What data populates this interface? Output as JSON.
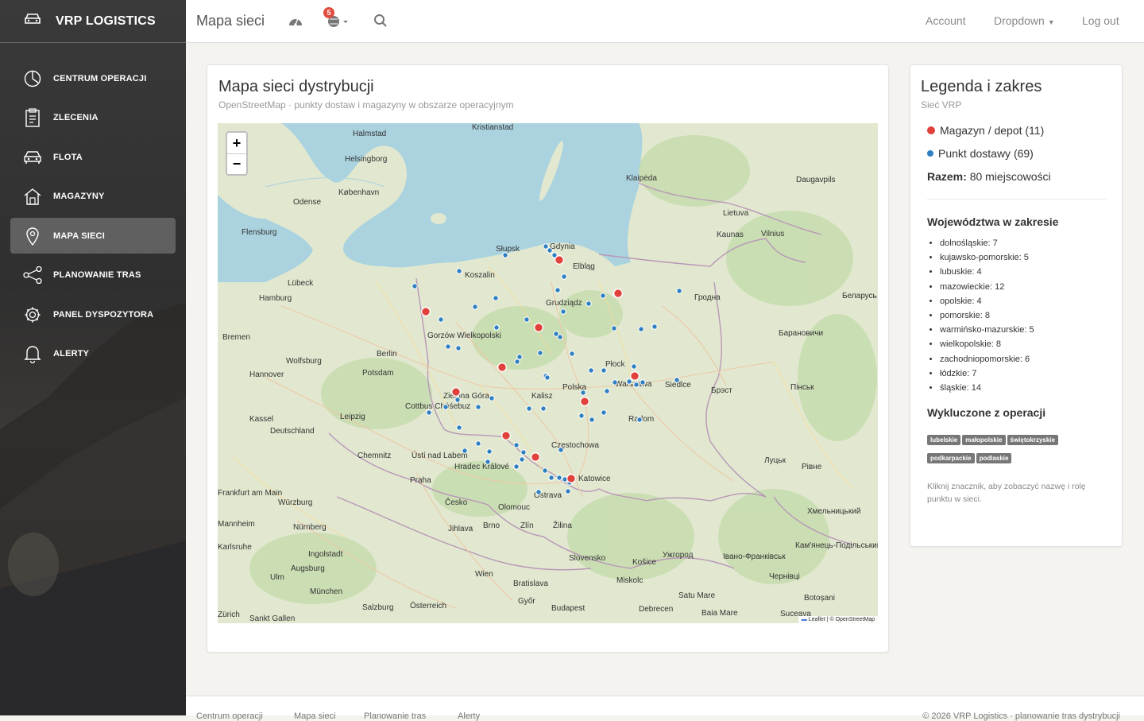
{
  "brand": {
    "name": "VRP LOGISTICS",
    "icon": "car-icon"
  },
  "sidebar": {
    "items": [
      {
        "label": "CENTRUM OPERACJI",
        "icon": "dashboard-icon",
        "active": false
      },
      {
        "label": "ZLECENIA",
        "icon": "clipboard-icon",
        "active": false
      },
      {
        "label": "FLOTA",
        "icon": "car-icon",
        "active": false
      },
      {
        "label": "MAGAZYNY",
        "icon": "warehouse-icon",
        "active": false
      },
      {
        "label": "MAPA SIECI",
        "icon": "map-pin-icon",
        "active": true
      },
      {
        "label": "PLANOWANIE TRAS",
        "icon": "share-icon",
        "active": false
      },
      {
        "label": "PANEL DYSPOZYTORA",
        "icon": "gear-icon",
        "active": false
      },
      {
        "label": "ALERTY",
        "icon": "bell-icon",
        "active": false
      }
    ]
  },
  "topbar": {
    "title": "Mapa sieci",
    "notifications_count": "5",
    "account": "Account",
    "dropdown": "Dropdown",
    "logout": "Log out"
  },
  "map_card": {
    "title": "Mapa sieci dystrybucji",
    "subtitle": "OpenStreetMap · punkty dostaw i magazyny w obszarze operacyjnym",
    "zoom_in": "+",
    "zoom_out": "−",
    "attribution": "Leaflet | © OpenStreetMap",
    "labels": [
      "Halmstad",
      "Helsingborg",
      "København",
      "Odense",
      "Flensburg",
      "Lübeck",
      "Hamburg",
      "Bremen",
      "Berlin",
      "Hannover",
      "Wolfsburg",
      "Potsdam",
      "Leipzig",
      "Kassel",
      "Deutschland",
      "Chemnitz",
      "Praha",
      "Česko",
      "Nürnberg",
      "Würzburg",
      "München",
      "Augsburg",
      "Ulm",
      "Zürich",
      "Wien",
      "Bratislava",
      "Budapest",
      "Brno",
      "Olomouc",
      "Zlín",
      "Žilina",
      "Slovensko",
      "Košice",
      "Ostrava",
      "Katowice",
      "Częstochowa",
      "Radom",
      "Warszawa",
      "Polska",
      "Płock",
      "Kalisz",
      "Zielona Góra",
      "Gorzów Wielkopolski",
      "Grudziądz",
      "Elbląg",
      "Słupsk",
      "Koszalin",
      "Gdynia",
      "Klaipėda",
      "Lietuva",
      "Kaunas",
      "Vilnius",
      "Гродна",
      "Беларусь",
      "Брэст",
      "Луцьк",
      "Рівне",
      "Ужгород",
      "Debrecen",
      "Miskolc",
      "Győr",
      "Salzburg",
      "Österreich",
      "Jihlava",
      "Hradec Králové",
      "Ústí nad Labem",
      "Siedlce",
      "Cottbus Chóśebuz",
      "Ingolstadt",
      "Sankt Gallen",
      "Frankfurt am Main",
      "Mannheim",
      "Karlsruhe",
      "Kristianstad",
      "Baia Mare",
      "Satu Mare",
      "Suceava",
      "Botoșani",
      "Daugavpils",
      "Барановичи",
      "Пінськ",
      "Кам'янець-Подільський",
      "Івано-Франківськ",
      "Чернівці",
      "Хмельницький"
    ],
    "markers": {
      "magazyn_color": "#e0413a",
      "punkt_color": "#2f7fc1"
    }
  },
  "legend": {
    "title": "Legenda i zakres",
    "subtitle": "Sieć VRP",
    "magazyn": "Magazyn / depot (11)",
    "punkt": "Punkt dostawy (69)",
    "total_label": "Razem:",
    "total_value": "80 miejscowości",
    "provinces_title": "Województwa w zakresie",
    "provinces": [
      "dolnośląskie: 7",
      "kujawsko-pomorskie: 5",
      "lubuskie: 4",
      "mazowieckie: 12",
      "opolskie: 4",
      "pomorskie: 8",
      "warmińsko-mazurskie: 5",
      "wielkopolskie: 8",
      "zachodniopomorskie: 6",
      "łódzkie: 7",
      "śląskie: 14"
    ],
    "excluded_title": "Wykluczone z operacji",
    "excluded": [
      "lubelskie",
      "małopolskie",
      "świętokrzyskie",
      "podkarpackie",
      "podlaskie"
    ],
    "hint": "Kliknij znacznik, aby zobaczyć nazwę i rolę punktu w sieci."
  },
  "footer": {
    "links": [
      "Centrum operacji",
      "Mapa sieci",
      "Planowanie tras",
      "Alerty"
    ],
    "copyright": "© 2026 VRP Logistics · planowanie tras dystrybucji"
  }
}
